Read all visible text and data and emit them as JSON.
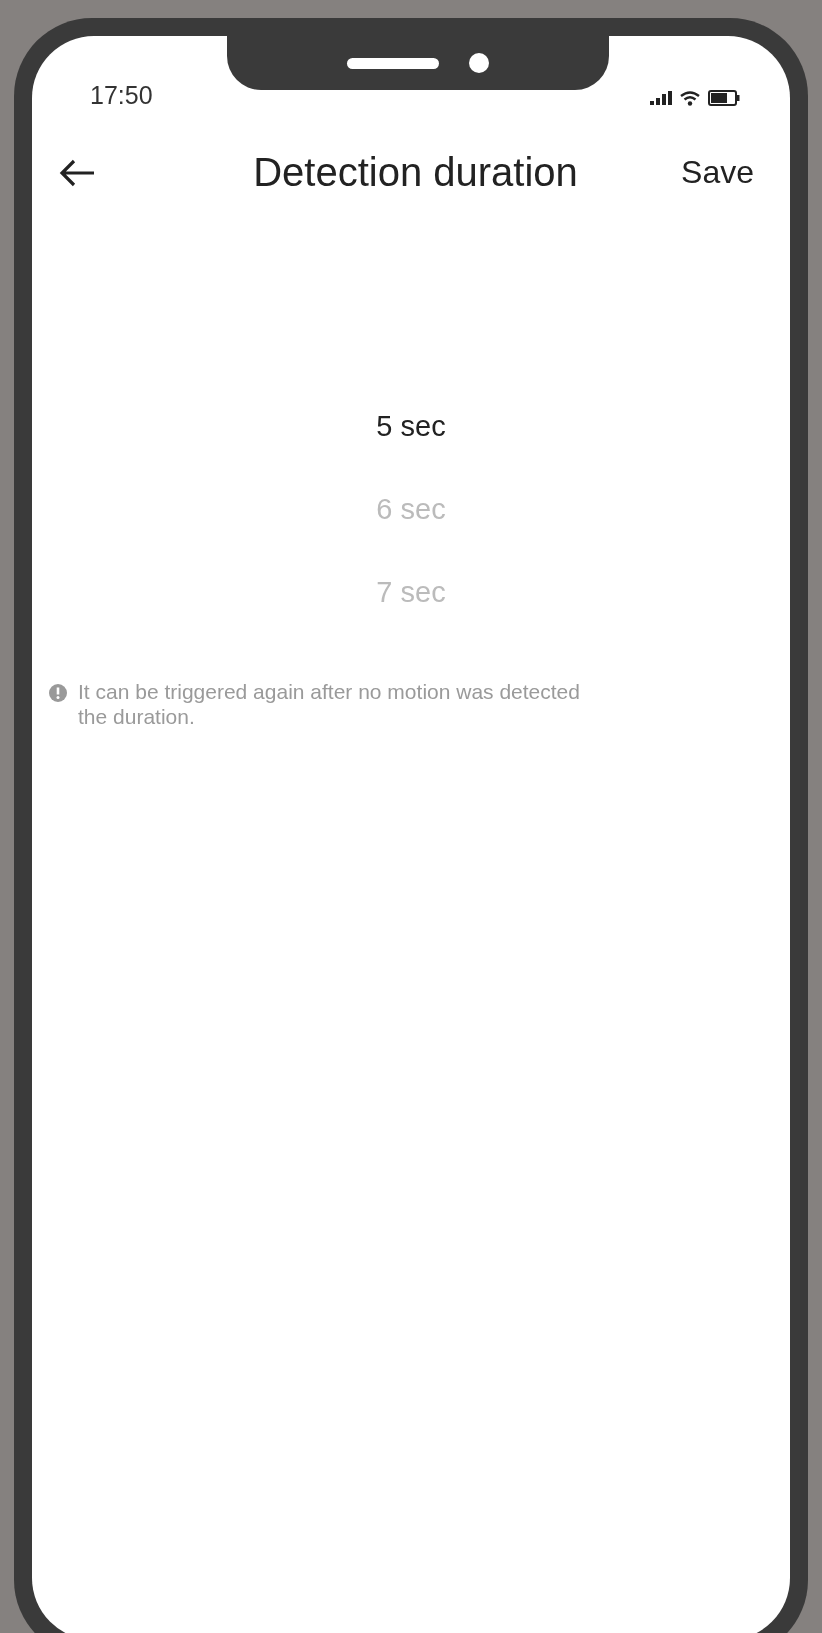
{
  "status_bar": {
    "time": "17:50"
  },
  "header": {
    "title": "Detection duration",
    "action": "Save"
  },
  "picker": {
    "options": [
      {
        "label": "5 sec",
        "selected": true
      },
      {
        "label": "6 sec",
        "selected": false
      },
      {
        "label": "7 sec",
        "selected": false
      }
    ]
  },
  "note": {
    "lines": [
      "It can be triggered again after no motion was detected",
      "the duration."
    ]
  }
}
